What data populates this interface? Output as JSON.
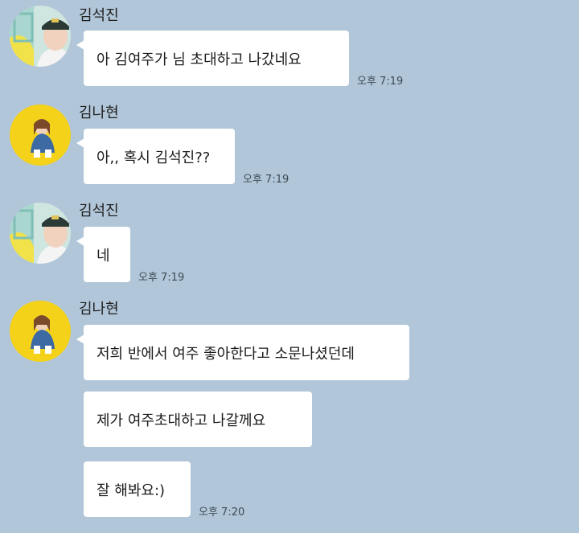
{
  "messages": [
    {
      "sender": "김석진",
      "avatar_icon": "profile-photo-icon",
      "bubbles": [
        {
          "text": "아 김여주가 님 초대하고 나갔네요",
          "time": "오후 7:19"
        }
      ]
    },
    {
      "sender": "김나현",
      "avatar_icon": "profile-photo-icon",
      "bubbles": [
        {
          "text": "아,, 혹시 김석진??",
          "time": "오후 7:19"
        }
      ]
    },
    {
      "sender": "김석진",
      "avatar_icon": "profile-photo-icon",
      "bubbles": [
        {
          "text": "네",
          "time": "오후 7:19"
        }
      ]
    },
    {
      "sender": "김나현",
      "avatar_icon": "profile-photo-icon",
      "bubbles": [
        {
          "text": "저희 반에서 여주 좋아한다고 소문나셨던데"
        },
        {
          "text": "제가 여주초대하고 나갈께요"
        },
        {
          "text": "잘 해봐요:)",
          "time": "오후 7:20"
        }
      ]
    }
  ],
  "colors": {
    "background": "#b1c6d8",
    "bubble": "#ffffff",
    "timestamp": "#3d4a55"
  }
}
